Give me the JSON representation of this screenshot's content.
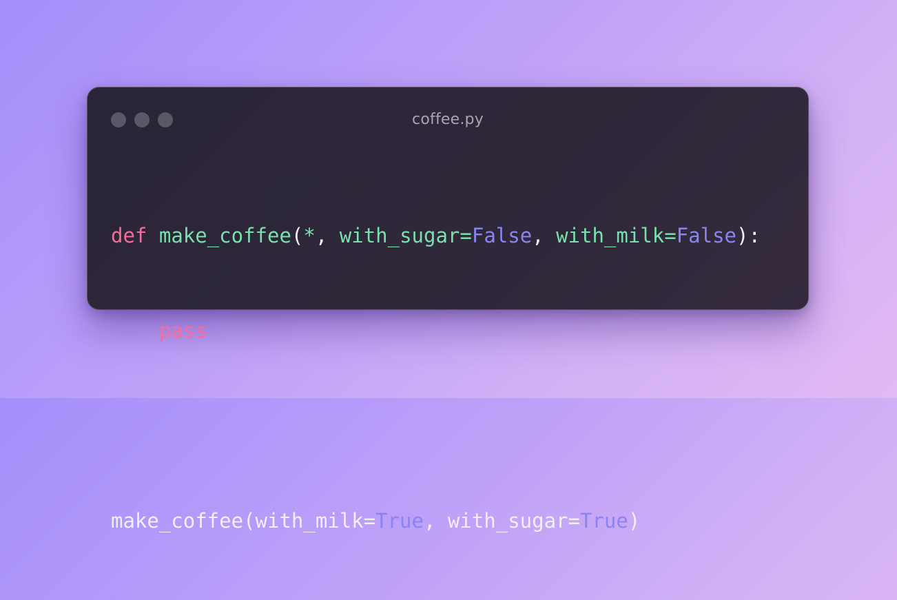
{
  "window": {
    "filename": "coffee.py",
    "controls": [
      "window-dot",
      "window-dot",
      "window-dot"
    ]
  },
  "code": {
    "line1": {
      "kw_def": "def",
      "fn_name": "make_coffee",
      "open_paren": "(",
      "star": "*",
      "comma1": ", ",
      "param1": "with_sugar",
      "eq1": "=",
      "val1": "False",
      "comma2": ", ",
      "param2": "with_milk",
      "eq2": "=",
      "val2": "False",
      "close": "):"
    },
    "line2": {
      "indent": "    ",
      "kw_pass": "pass"
    },
    "line4": {
      "fn_name": "make_coffee",
      "open_paren": "(",
      "arg1": "with_milk",
      "eq1": "=",
      "val1": "True",
      "comma": ", ",
      "arg2": "with_sugar",
      "eq2": "=",
      "val2": "True",
      "close": ")"
    }
  },
  "colors": {
    "keyword": "#f76c9a",
    "function": "#79e0ad",
    "constant": "#8a84f2",
    "text": "#f1eef6",
    "window_bg": "#2e2839"
  }
}
